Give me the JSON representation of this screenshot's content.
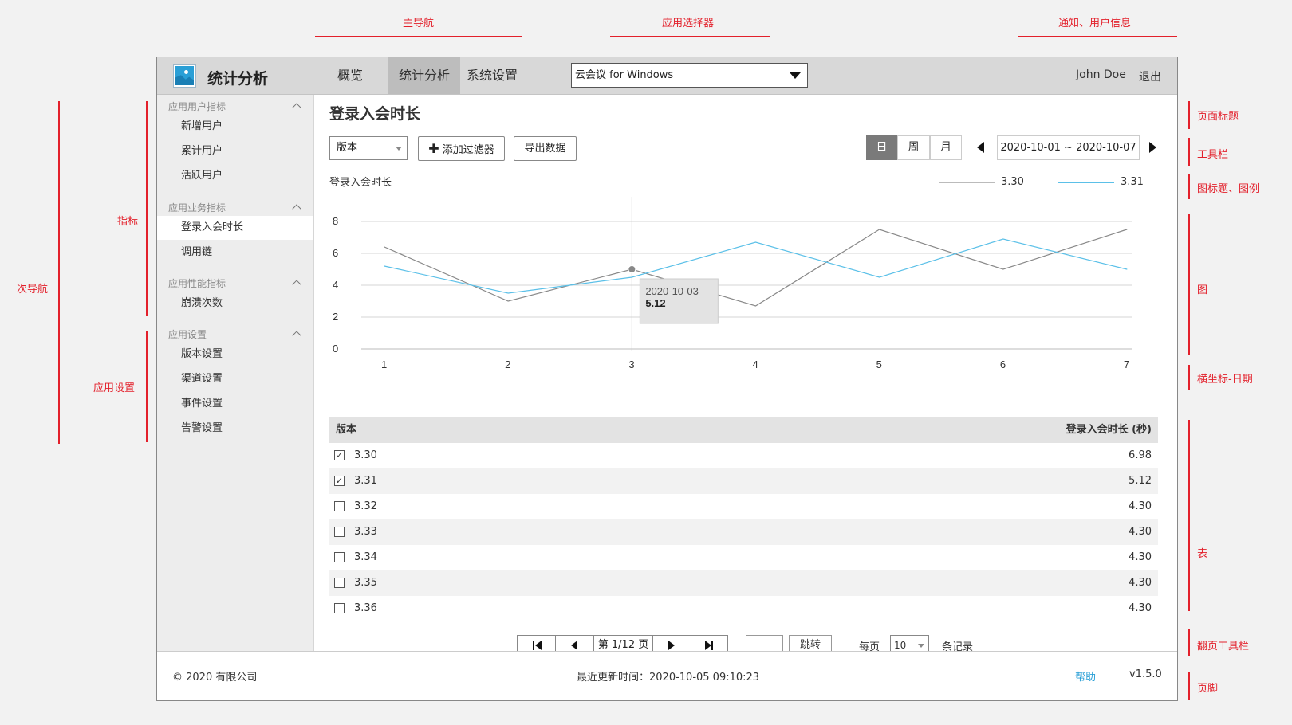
{
  "annotations": {
    "main_nav": "主导航",
    "app_selector": "应用选择器",
    "notify_user": "通知、用户信息",
    "secondary_nav": "次导航",
    "metrics": "指标",
    "app_settings": "应用设置",
    "page_title": "页面标题",
    "toolbar": "工具栏",
    "chart_title_legend": "图标题、图例",
    "chart": "图",
    "x_axis_date": "横坐标-日期",
    "table": "表",
    "pager_toolbar": "翻页工具栏",
    "footer": "页脚"
  },
  "header": {
    "app_title": "统计分析",
    "tabs": [
      {
        "label": "概览"
      },
      {
        "label": "统计分析"
      },
      {
        "label": "系统设置"
      }
    ],
    "app_select_value": "云会议 for Windows",
    "user_name": "John Doe",
    "logout": "退出"
  },
  "sidebar": {
    "groups": [
      {
        "label": "应用用户指标",
        "items": [
          "新增用户",
          "累计用户",
          "活跃用户"
        ]
      },
      {
        "label": "应用业务指标",
        "items": [
          "登录入会时长",
          "调用链"
        ]
      },
      {
        "label": "应用性能指标",
        "items": [
          "崩溃次数"
        ]
      },
      {
        "label": "应用设置",
        "items": [
          "版本设置",
          "渠道设置",
          "事件设置",
          "告警设置"
        ]
      }
    ]
  },
  "main": {
    "page_title": "登录入会时长",
    "version_select": "版本",
    "add_filter": "添加过滤器",
    "export": "导出数据",
    "period": {
      "day": "日",
      "week": "周",
      "month": "月"
    },
    "date_range": "2020-10-01 ~ 2020-10-07",
    "chart_title": "登录入会时长",
    "tooltip": {
      "date": "2020-10-03",
      "value": "5.12"
    },
    "table_header": {
      "version": "版本",
      "value": "登录入会时长 (秒)"
    },
    "rows": [
      {
        "version": "3.30",
        "value": "6.98",
        "checked": true
      },
      {
        "version": "3.31",
        "value": "5.12",
        "checked": true
      },
      {
        "version": "3.32",
        "value": "4.30",
        "checked": false
      },
      {
        "version": "3.33",
        "value": "4.30",
        "checked": false
      },
      {
        "version": "3.34",
        "value": "4.30",
        "checked": false
      },
      {
        "version": "3.35",
        "value": "4.30",
        "checked": false
      },
      {
        "version": "3.36",
        "value": "4.30",
        "checked": false
      }
    ],
    "pager": {
      "page_text": "第 1/12 页",
      "jump": "跳转",
      "per_page": "每页",
      "per_page_value": "10",
      "records": "条记录"
    }
  },
  "footer": {
    "copyright": "© 2020 有限公司",
    "updated": "最近更新时间：2020-10-05 09:10:23",
    "help": "帮助",
    "version": "v1.5.0"
  },
  "colors": {
    "series_330": "#888888",
    "series_331": "#5bc0e8",
    "help_link": "#2a9fd6"
  },
  "chart_data": {
    "type": "line",
    "x": [
      1,
      2,
      3,
      4,
      5,
      6,
      7
    ],
    "ylim": [
      0,
      8
    ],
    "yticks": [
      0,
      2,
      4,
      6,
      8
    ],
    "grid": true,
    "legend_position": "top-right",
    "series": [
      {
        "name": "3.30",
        "values": [
          6.4,
          3.0,
          5.0,
          2.7,
          7.5,
          5.0,
          7.5
        ]
      },
      {
        "name": "3.31",
        "values": [
          5.2,
          3.5,
          4.5,
          6.7,
          4.5,
          6.9,
          5.0
        ]
      }
    ]
  }
}
